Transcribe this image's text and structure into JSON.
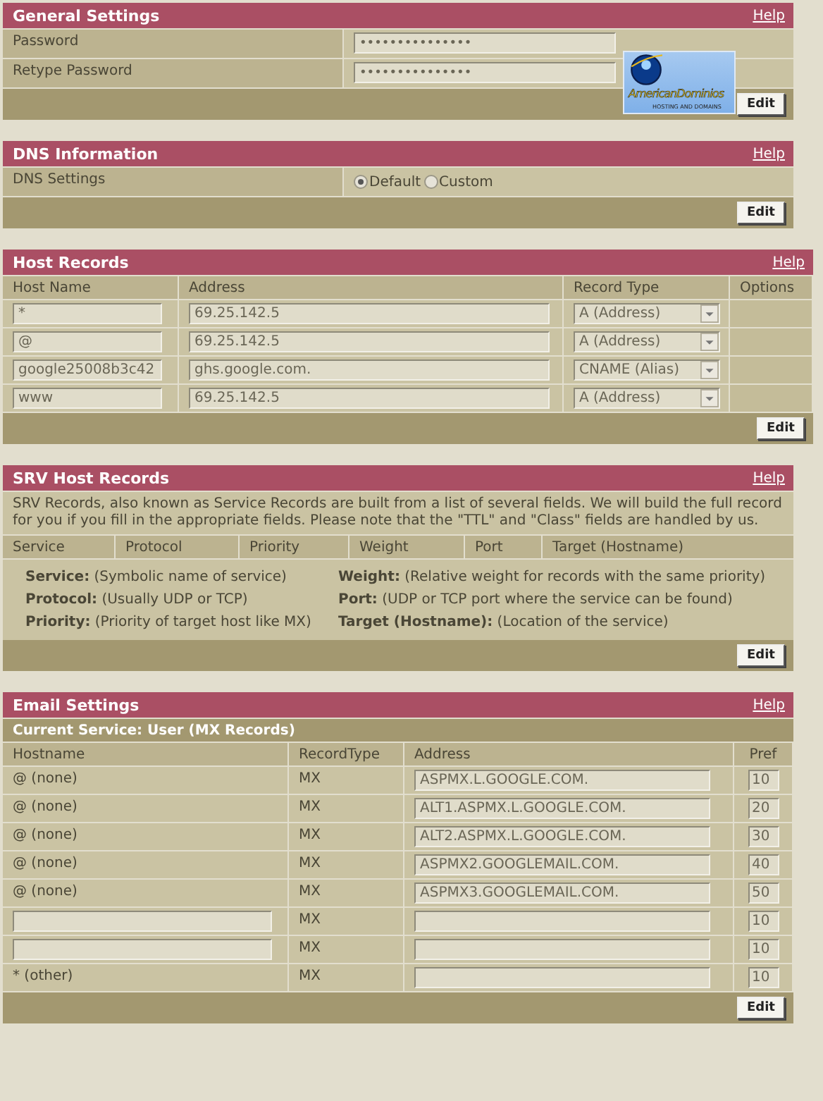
{
  "general": {
    "title": "General Settings",
    "help": "Help",
    "rows": [
      {
        "label": "Password",
        "value": "•••••••••••••••"
      },
      {
        "label": "Retype Password",
        "value": "•••••••••••••••"
      }
    ],
    "logo": {
      "name": "AmericanDominios",
      "tagline": "HOSTING AND DOMAINS"
    },
    "edit": "Edit"
  },
  "dns": {
    "title": "DNS Information",
    "help": "Help",
    "label": "DNS Settings",
    "options": [
      {
        "label": "Default",
        "selected": true
      },
      {
        "label": "Custom",
        "selected": false
      }
    ],
    "edit": "Edit"
  },
  "host_records": {
    "title": "Host Records",
    "help": "Help",
    "columns": [
      "Host Name",
      "Address",
      "Record Type",
      "Options"
    ],
    "rows": [
      {
        "host": "*",
        "address": "69.25.142.5",
        "type": "A (Address)"
      },
      {
        "host": "@",
        "address": "69.25.142.5",
        "type": "A (Address)"
      },
      {
        "host": "google25008b3c42",
        "address": "ghs.google.com.",
        "type": "CNAME (Alias)"
      },
      {
        "host": "www",
        "address": "69.25.142.5",
        "type": "A (Address)"
      }
    ],
    "edit": "Edit"
  },
  "srv": {
    "title": "SRV Host Records",
    "help": "Help",
    "intro": "SRV Records, also known as Service Records are built from a list of several fields. We will build the full record for you if you fill in the appropriate fields. Please note that the \"TTL\" and \"Class\" fields are handled by us.",
    "columns": [
      "Service",
      "Protocol",
      "Priority",
      "Weight",
      "Port",
      "Target (Hostname)"
    ],
    "notes": [
      "**Service:** (Symbolic name of service)",
      "**Weight:** (Relative weight for records with the same priority)",
      "**Protocol:** (Usually UDP or TCP)",
      "**Port:** (UDP or TCP port where the service can be found)",
      "**Priority:** (Priority of target host like MX)",
      "**Target (Hostname):** (Location of the service)"
    ],
    "edit": "Edit"
  },
  "email": {
    "title": "Email Settings",
    "help": "Help",
    "current_service": "Current Service: User (MX Records)",
    "columns": [
      "Hostname",
      "RecordType",
      "Address",
      "Pref"
    ],
    "rows": [
      {
        "kind": "text",
        "host": "@ (none)",
        "type": "MX",
        "address": "ASPMX.L.GOOGLE.COM.",
        "pref": "10"
      },
      {
        "kind": "text",
        "host": "@ (none)",
        "type": "MX",
        "address": "ALT1.ASPMX.L.GOOGLE.COM.",
        "pref": "20"
      },
      {
        "kind": "text",
        "host": "@ (none)",
        "type": "MX",
        "address": "ALT2.ASPMX.L.GOOGLE.COM.",
        "pref": "30"
      },
      {
        "kind": "text",
        "host": "@ (none)",
        "type": "MX",
        "address": "ASPMX2.GOOGLEMAIL.COM.",
        "pref": "40"
      },
      {
        "kind": "text",
        "host": "@ (none)",
        "type": "MX",
        "address": "ASPMX3.GOOGLEMAIL.COM.",
        "pref": "50"
      },
      {
        "kind": "field",
        "type": "MX",
        "pref": "10"
      },
      {
        "kind": "field",
        "type": "MX",
        "pref": "10"
      },
      {
        "kind": "text",
        "host": "* (other)",
        "type": "MX",
        "pref": "10"
      }
    ],
    "edit": "Edit"
  }
}
